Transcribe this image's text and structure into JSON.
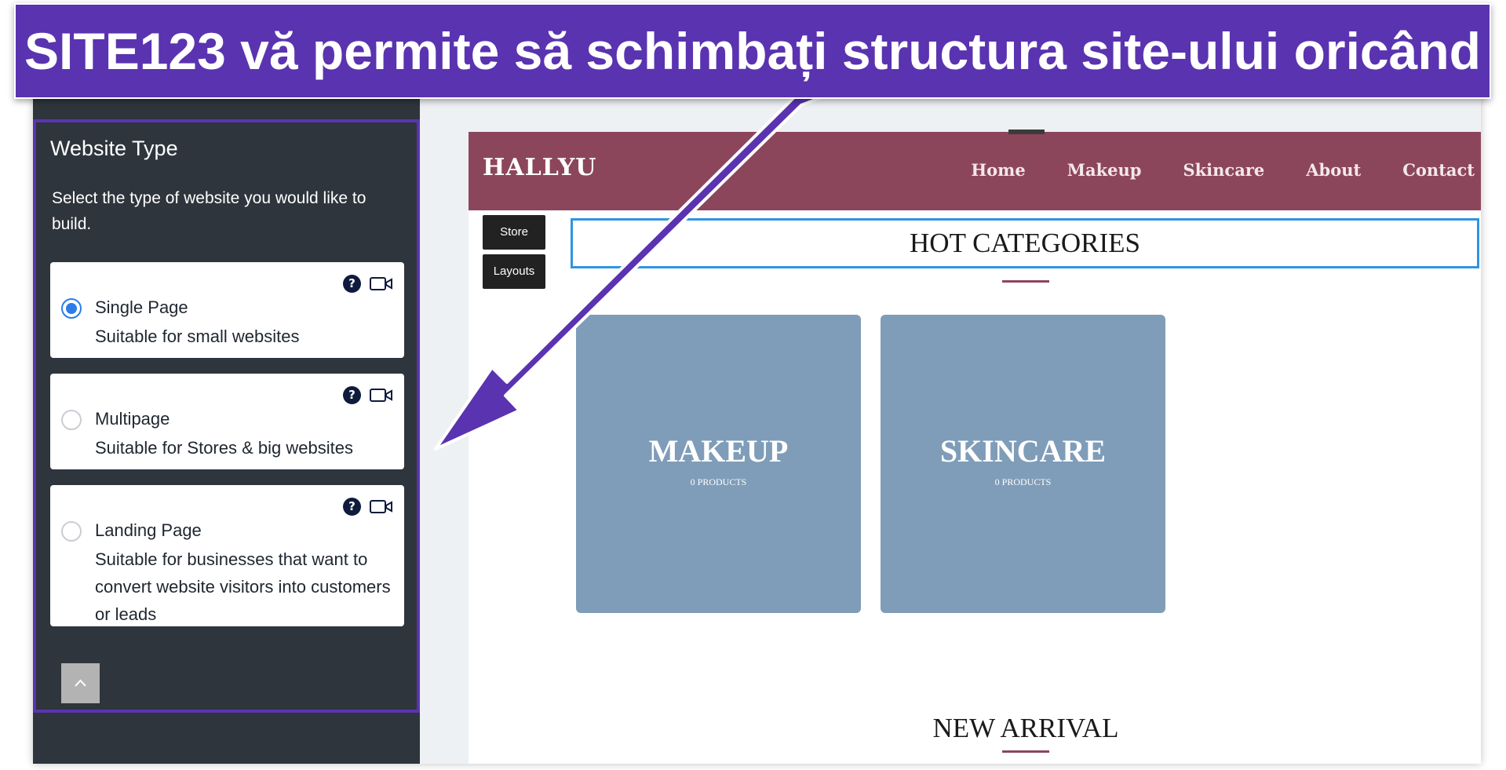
{
  "banner": {
    "text": "SITE123 vă permite să schimbați structura site-ului oricând"
  },
  "panel": {
    "title": "Website Type",
    "description": "Select the type of website you would like to build.",
    "options": [
      {
        "title": "Single Page",
        "desc": "Suitable for small websites",
        "selected": true
      },
      {
        "title": "Multipage",
        "desc": "Suitable for Stores & big websites",
        "selected": false
      },
      {
        "title": "Landing Page",
        "desc": "Suitable for businesses that want to convert website visitors into customers or leads",
        "selected": false
      }
    ],
    "help_icon_glyph": "?",
    "colors": {
      "panel_bg": "#2e353c",
      "highlight": "#5a33b0",
      "radio_selected": "#2b7de9"
    }
  },
  "preview": {
    "brand": "HALLYU",
    "nav": [
      "Home",
      "Makeup",
      "Skincare",
      "About",
      "Contact"
    ],
    "buttons": {
      "store": "Store",
      "layouts": "Layouts"
    },
    "hot_title": "HOT CATEGORIES",
    "categories": [
      {
        "name": "MAKEUP",
        "count": "0 PRODUCTS"
      },
      {
        "name": "SKINCARE",
        "count": "0 PRODUCTS"
      }
    ],
    "new_arrival": "NEW ARRIVAL",
    "scroll_top_icon": "chevron-up-icon",
    "colors": {
      "navbar": "#8c465c",
      "category_tile": "#7f9db8",
      "selection_border": "#2f95e0"
    }
  }
}
